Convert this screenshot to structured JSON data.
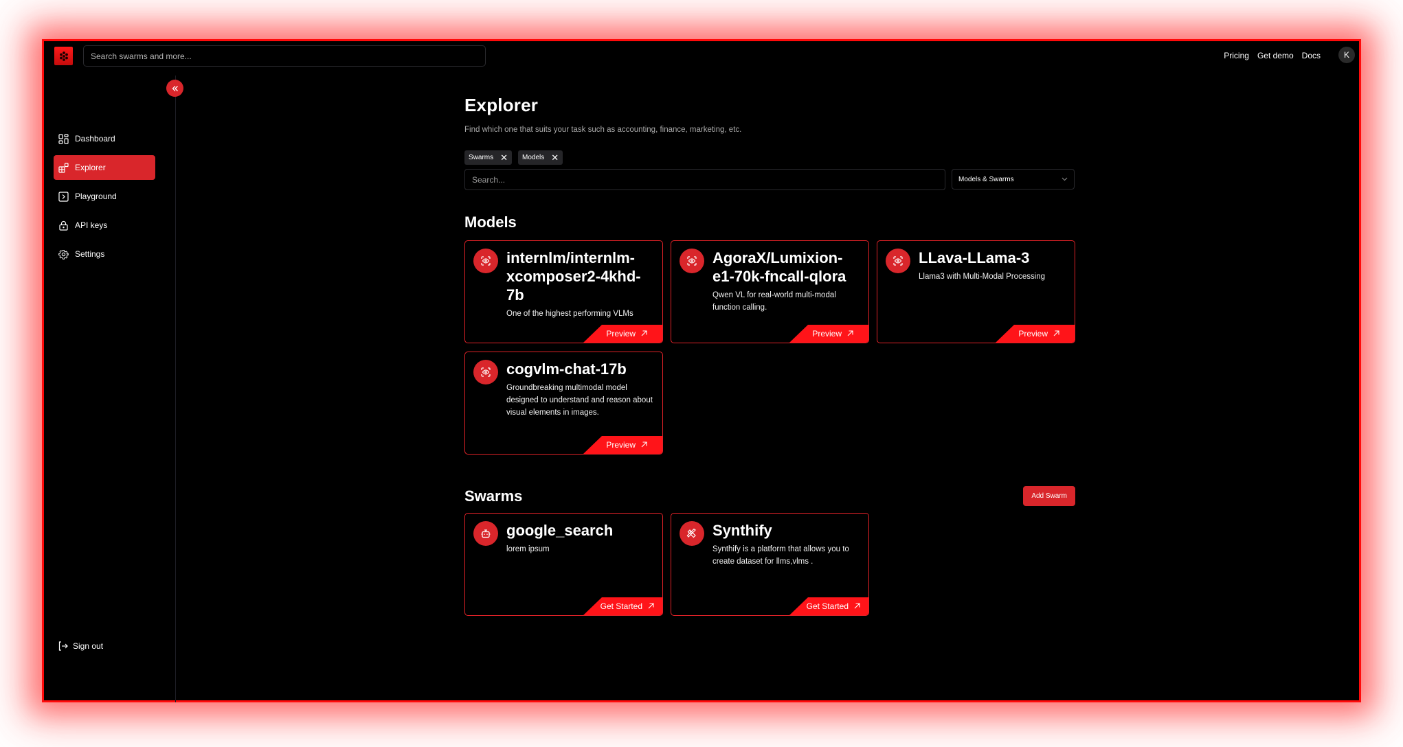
{
  "topbar": {
    "search_placeholder": "Search swarms and more...",
    "links": [
      "Pricing",
      "Get demo",
      "Docs"
    ],
    "avatar_initial": "K"
  },
  "sidebar": {
    "collapse_icon": "chevrons-left-icon",
    "items": [
      {
        "label": "Dashboard",
        "icon": "dashboard-icon",
        "active": false
      },
      {
        "label": "Explorer",
        "icon": "explorer-icon",
        "active": true
      },
      {
        "label": "Playground",
        "icon": "terminal-icon",
        "active": false
      },
      {
        "label": "API keys",
        "icon": "lock-icon",
        "active": false
      },
      {
        "label": "Settings",
        "icon": "gear-icon",
        "active": false
      }
    ],
    "signout_label": "Sign out"
  },
  "main": {
    "title": "Explorer",
    "subtitle": "Find which one that suits your task such as accounting, finance, marketing, etc.",
    "chips": [
      "Swarms",
      "Models"
    ],
    "search_placeholder": "Search...",
    "filter_select": "Models & Swarms",
    "models_title": "Models",
    "models": [
      {
        "name": "internlm/internlm-xcomposer2-4khd-7b",
        "description": "One of the highest performing VLMs",
        "cta": "Preview"
      },
      {
        "name": "AgoraX/Lumixion-e1-70k-fncall-qlora",
        "description": "Qwen VL for real-world multi-modal function calling.",
        "cta": "Preview"
      },
      {
        "name": "LLava-LLama-3",
        "description": "Llama3 with Multi-Modal Processing",
        "cta": "Preview"
      },
      {
        "name": "cogvlm-chat-17b",
        "description": "Groundbreaking multimodal model designed to understand and reason about visual elements in images.",
        "cta": "Preview"
      }
    ],
    "swarms_title": "Swarms",
    "add_swarm_label": "Add Swarm",
    "swarms": [
      {
        "name": "google_search",
        "description": "lorem ipsum",
        "cta": "Get Started",
        "icon": "bot-icon"
      },
      {
        "name": "Synthify",
        "description": "Synthify is a platform that allows you to create dataset for llms,vlms .",
        "cta": "Get Started",
        "icon": "pencil-ruler-icon"
      }
    ]
  },
  "colors": {
    "accent": "#d9262b",
    "cta": "#ff1419",
    "frame": "#ff0a0a"
  }
}
